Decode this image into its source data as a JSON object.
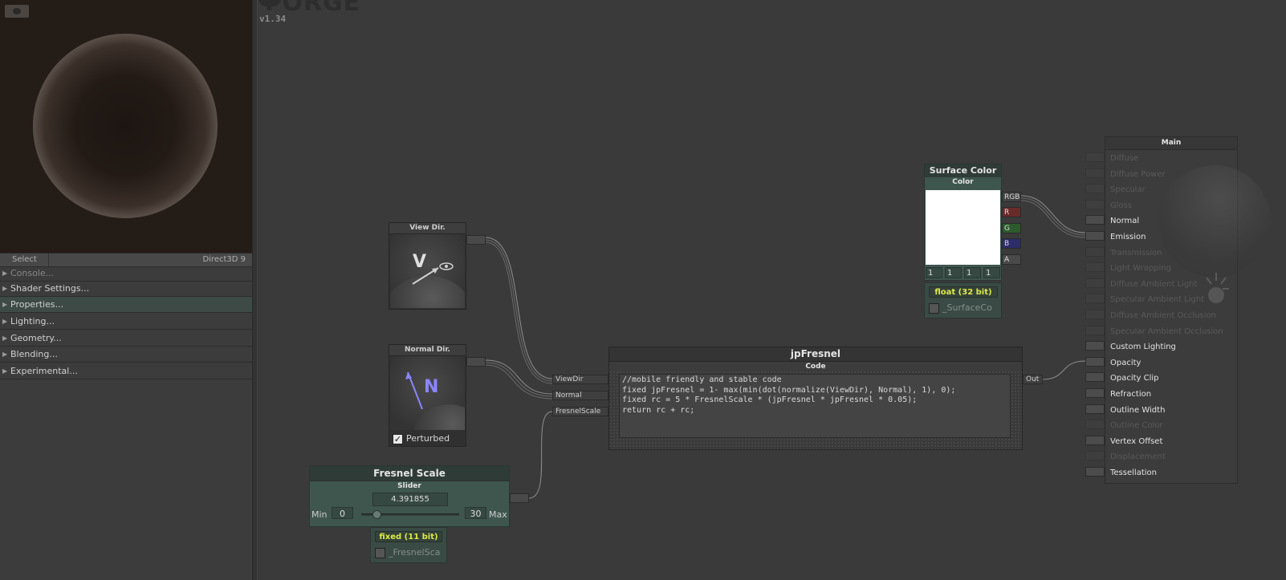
{
  "left_panel": {
    "select_label": "Select",
    "renderer": "Direct3D 9",
    "sections": [
      {
        "label": "Console...",
        "disabled": true
      },
      {
        "label": "Shader Settings...",
        "disabled": false
      },
      {
        "label": "Properties...",
        "active": true
      },
      {
        "label": "Lighting..."
      },
      {
        "label": "Geometry..."
      },
      {
        "label": "Blending..."
      },
      {
        "label": "Experimental..."
      }
    ]
  },
  "app": {
    "logo": "FORGE",
    "version": "v1.34"
  },
  "nodes": {
    "view_dir": {
      "title": "View Dir.",
      "letter": "V"
    },
    "normal_dir": {
      "title": "Normal Dir.",
      "letter": "N",
      "perturbed_label": "Perturbed",
      "perturbed_checked": true
    },
    "fresnel_scale": {
      "title": "Fresnel Scale",
      "subtitle": "Slider",
      "value": "4.391855",
      "min_label": "Min",
      "min": "0",
      "max_label": "Max",
      "max": "30",
      "precision": "fixed (11 bit)",
      "variable": "_FresnelSca"
    },
    "surface_color": {
      "title": "Surface Color",
      "subtitle": "Color",
      "channels": [
        "RGB",
        "R",
        "G",
        "B",
        "A"
      ],
      "rgba": [
        "1",
        "1",
        "1",
        "1"
      ],
      "precision": "float (32 bit)",
      "variable": "_SurfaceCo"
    },
    "jp_fresnel": {
      "title": "jpFresnel",
      "subtitle": "Code",
      "inputs": [
        "ViewDir",
        "Normal",
        "FresnelScale"
      ],
      "output": "Out",
      "code": "//mobile friendly and stable code\nfixed jpFresnel = 1- max(min(dot(normalize(ViewDir), Normal), 1), 0);\nfixed rc = 5 * FresnelScale * (jpFresnel * jpFresnel * 0.05);\nreturn rc + rc;"
    },
    "main": {
      "title": "Main",
      "inputs": [
        {
          "label": "Diffuse",
          "enabled": false
        },
        {
          "label": "Diffuse Power",
          "enabled": false
        },
        {
          "label": "Specular",
          "enabled": false
        },
        {
          "label": "Gloss",
          "enabled": false
        },
        {
          "label": "Normal",
          "enabled": true
        },
        {
          "label": "Emission",
          "enabled": true
        },
        {
          "label": "Transmission",
          "enabled": false
        },
        {
          "label": "Light Wrapping",
          "enabled": false
        },
        {
          "label": "Diffuse Ambient Light",
          "enabled": false
        },
        {
          "label": "Specular Ambient Light",
          "enabled": false
        },
        {
          "label": "Diffuse Ambient Occlusion",
          "enabled": false
        },
        {
          "label": "Specular Ambient Occlusion",
          "enabled": false
        },
        {
          "label": "Custom Lighting",
          "enabled": true
        },
        {
          "label": "Opacity",
          "enabled": true
        },
        {
          "label": "Opacity Clip",
          "enabled": true
        },
        {
          "label": "Refraction",
          "enabled": true
        },
        {
          "label": "Outline Width",
          "enabled": true
        },
        {
          "label": "Outline Color",
          "enabled": false
        },
        {
          "label": "Vertex Offset",
          "enabled": true
        },
        {
          "label": "Displacement",
          "enabled": false
        },
        {
          "label": "Tessellation",
          "enabled": true
        }
      ]
    }
  },
  "colors": {
    "accent": "#3f564f",
    "precision_text": "#ddea46",
    "view_arrow": "#d0d0d0",
    "normal_arrow": "#8a86ff",
    "chan_r": "#6a2a2a",
    "chan_g": "#2d5a2d",
    "chan_b": "#2d2d6a"
  }
}
